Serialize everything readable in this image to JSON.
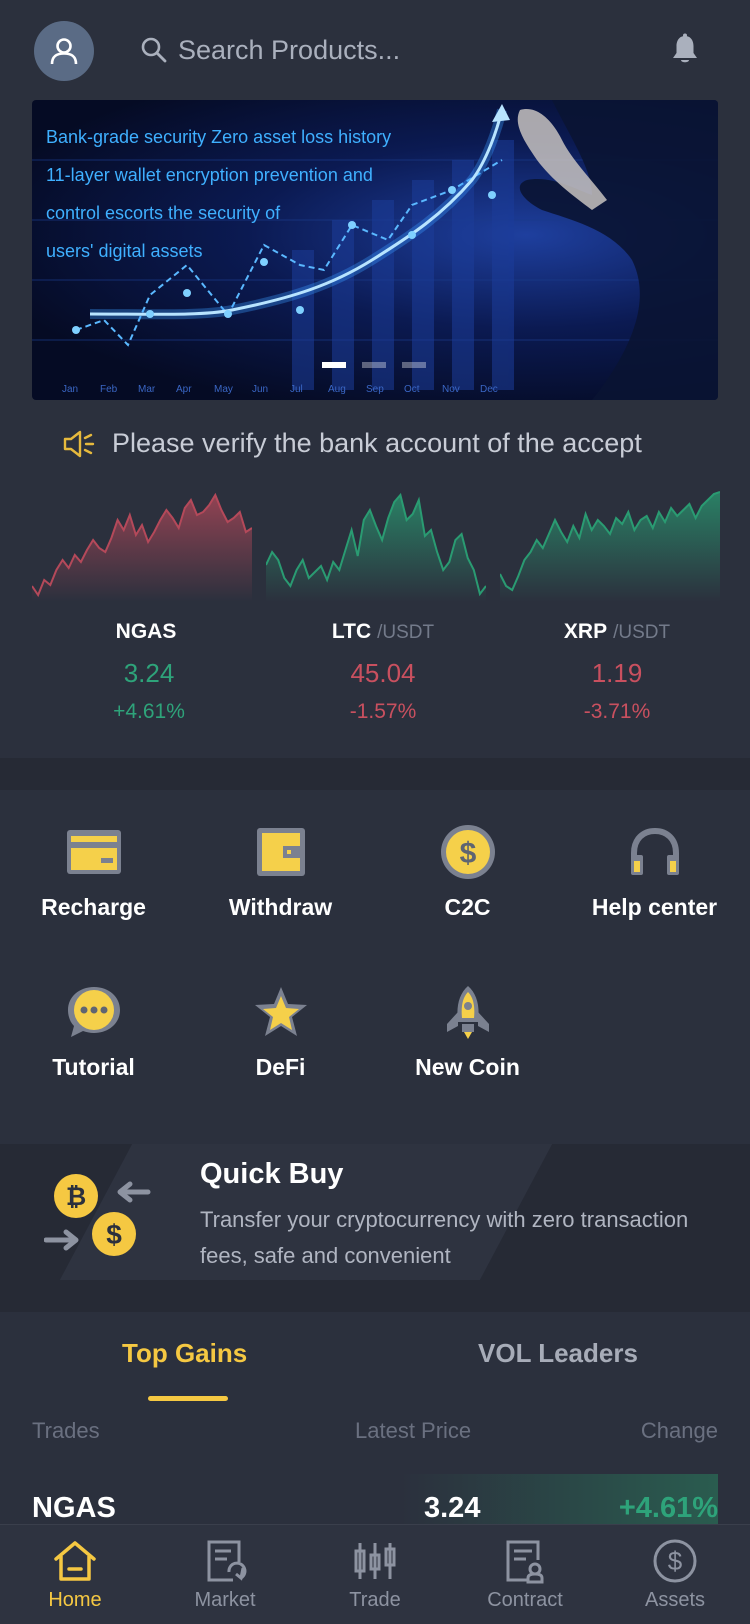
{
  "header": {
    "search_placeholder": "Search Products..."
  },
  "banner": {
    "lines": [
      "Bank-grade security Zero asset loss history",
      "11-layer wallet encryption prevention and",
      "control escorts the security of",
      "users' digital assets"
    ],
    "months": [
      "Jan",
      "Feb",
      "Mar",
      "Apr",
      "May",
      "Jun",
      "Jul",
      "Aug",
      "Sep",
      "Oct",
      "Nov",
      "Dec"
    ],
    "active_slide": 1,
    "slide_count": 3
  },
  "notice": {
    "text": "Please verify the bank account of the accept"
  },
  "tickers": [
    {
      "name": "NGAS",
      "pair": "",
      "price": "3.24",
      "change": "+4.61%",
      "trend": "up-red-chart",
      "color": "#2ea37a",
      "chart_color": "#b4495a"
    },
    {
      "name": "LTC",
      "pair": "/USDT",
      "price": "45.04",
      "change": "-1.57%",
      "trend": "down",
      "color": "#c9505f",
      "chart_color": "#2a9b72"
    },
    {
      "name": "XRP",
      "pair": "/USDT",
      "price": "1.19",
      "change": "-3.71%",
      "trend": "down",
      "color": "#c9505f",
      "chart_color": "#2a9b72"
    }
  ],
  "menu": [
    {
      "label": "Recharge",
      "icon": "card-icon"
    },
    {
      "label": "Withdraw",
      "icon": "wallet-icon"
    },
    {
      "label": "C2C",
      "icon": "dollar-coin-icon"
    },
    {
      "label": "Help center",
      "icon": "headphones-icon"
    },
    {
      "label": "Tutorial",
      "icon": "chat-bubble-icon"
    },
    {
      "label": "DeFi",
      "icon": "star-icon"
    },
    {
      "label": "New Coin",
      "icon": "rocket-icon"
    }
  ],
  "quick_buy": {
    "title": "Quick Buy",
    "description": "Transfer your cryptocurrency with zero transaction fees, safe and convenient"
  },
  "tabs": {
    "top_gains": "Top Gains",
    "vol_leaders": "VOL Leaders",
    "active": "top_gains"
  },
  "table": {
    "headers": {
      "trades": "Trades",
      "latest_price": "Latest Price",
      "change": "Change"
    },
    "rows": [
      {
        "name": "NGAS",
        "price": "3.24",
        "change": "+4.61%"
      }
    ]
  },
  "nav": {
    "items": [
      {
        "label": "Home",
        "icon": "home-icon",
        "active": true
      },
      {
        "label": "Market",
        "icon": "market-icon",
        "active": false
      },
      {
        "label": "Trade",
        "icon": "trade-icon",
        "active": false
      },
      {
        "label": "Contract",
        "icon": "contract-icon",
        "active": false
      },
      {
        "label": "Assets",
        "icon": "assets-icon",
        "active": false
      }
    ]
  },
  "colors": {
    "background": "#2b303d",
    "accent": "#f5c842",
    "up": "#2ea37a",
    "down": "#c9505f"
  }
}
